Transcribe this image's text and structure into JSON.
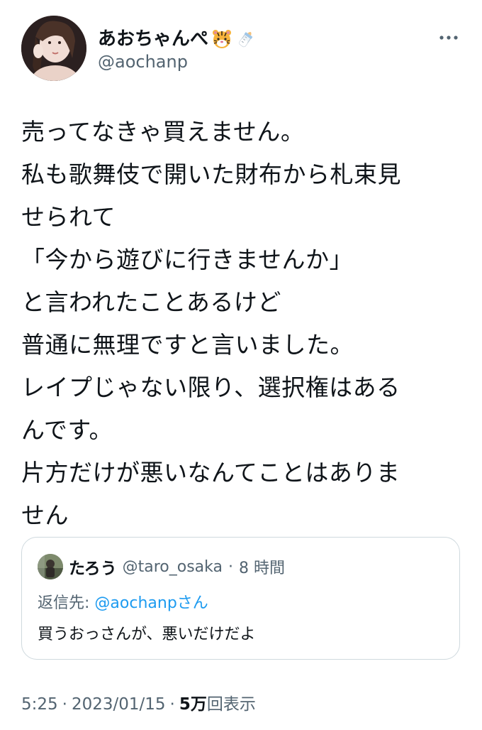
{
  "author": {
    "display_name": "あおちゃんぺ",
    "handle": "@aochanp",
    "emojis": [
      "tiger-face-emoji",
      "baby-bottle-emoji"
    ]
  },
  "tweet": {
    "lines": [
      "売ってなきゃ買えません。",
      "私も歌舞伎で開いた財布から札束見",
      "せられて",
      "「今から遊びに行きませんか」",
      "と言われたことあるけど",
      "普通に無理ですと言いました。",
      "レイプじゃない限り、選択権はある",
      "んです。",
      "片方だけが悪いなんてことはありま",
      "せん"
    ]
  },
  "quote": {
    "name": "たろう",
    "handle": "@taro_osaka",
    "separator": "·",
    "time": "8 時間",
    "reply_prefix": "返信先:",
    "reply_mention": "@aochanp",
    "reply_suffix": "さん",
    "text": "買うおっさんが、悪いだけだよ"
  },
  "meta": {
    "time": "5:25",
    "sep1": "·",
    "date": "2023/01/15",
    "sep2": "·",
    "views_count": "5万",
    "views_label": "回表示"
  },
  "colors": {
    "text": "#0f1419",
    "secondary": "#536471",
    "link": "#1d9bf0",
    "border": "#cfd9de"
  },
  "icons": {
    "more": "more-horizontal-icon"
  }
}
